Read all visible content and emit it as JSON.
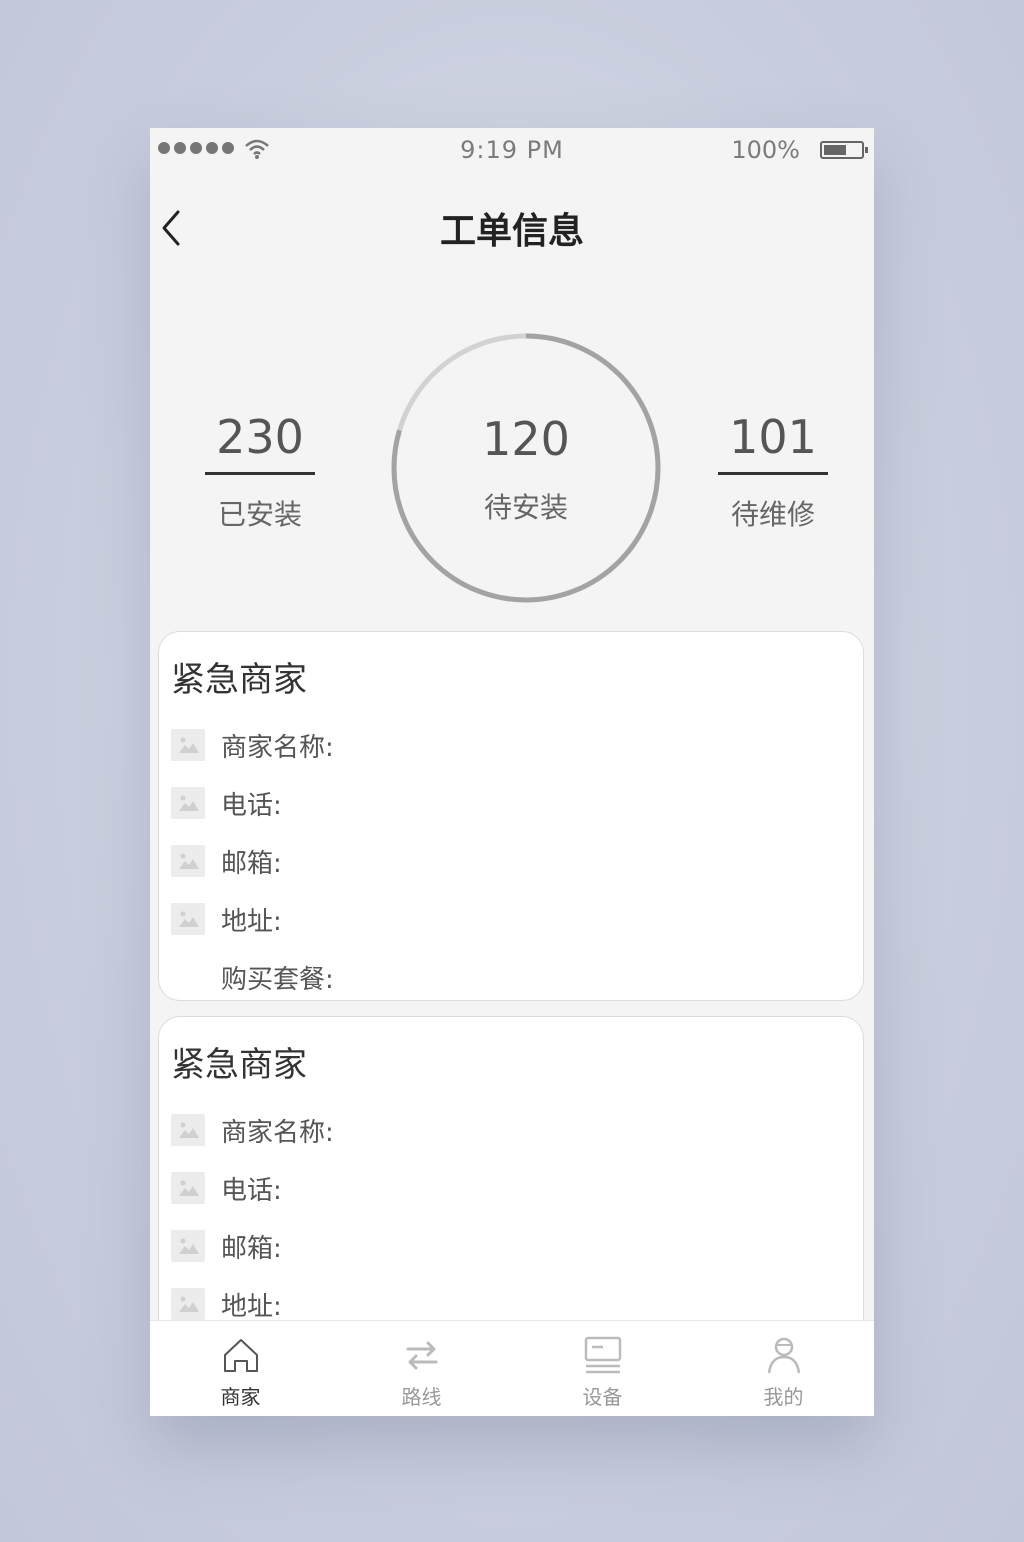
{
  "status_bar": {
    "time": "9:19 PM",
    "battery": "100%"
  },
  "nav": {
    "title": "工单信息"
  },
  "stats": {
    "installed": {
      "value": "230",
      "label": "已安装"
    },
    "pending_install": {
      "value": "120",
      "label": "待安装"
    },
    "pending_repair": {
      "value": "101",
      "label": "待维修"
    }
  },
  "cards": [
    {
      "title": "紧急商家",
      "rows": [
        {
          "label": "商家名称:"
        },
        {
          "label": "电话:"
        },
        {
          "label": "邮箱:"
        },
        {
          "label": "地址:"
        },
        {
          "label": "购买套餐:"
        }
      ]
    },
    {
      "title": "紧急商家",
      "rows": [
        {
          "label": "商家名称:"
        },
        {
          "label": "电话:"
        },
        {
          "label": "邮箱:"
        },
        {
          "label": "地址:"
        }
      ]
    }
  ],
  "tabs": [
    {
      "label": "商家",
      "icon": "home-icon"
    },
    {
      "label": "路线",
      "icon": "route-icon"
    },
    {
      "label": "设备",
      "icon": "device-icon"
    },
    {
      "label": "我的",
      "icon": "profile-icon"
    }
  ],
  "colors": {
    "accent": "#333333",
    "muted": "#999999",
    "background": "#f4f4f4"
  }
}
